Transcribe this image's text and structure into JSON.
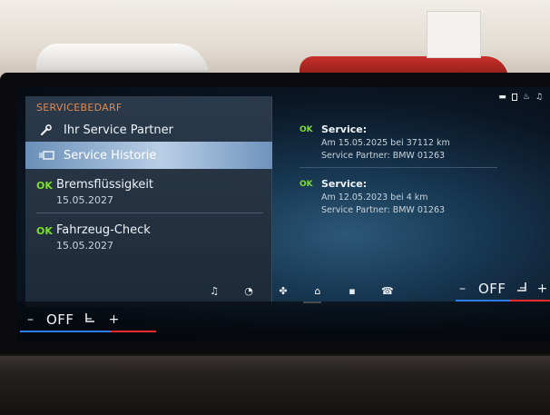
{
  "header": {
    "title": "SERVICEBEDARF"
  },
  "menu": [
    {
      "label": "Ihr Service Partner",
      "icon": "wrench-icon"
    },
    {
      "label": "Service Historie",
      "icon": "service-history-icon"
    }
  ],
  "status_items": [
    {
      "status": "OK",
      "label": "Bremsflüssigkeit",
      "date": "15.05.2027"
    },
    {
      "status": "OK",
      "label": "Fahrzeug-Check",
      "date": "15.05.2027"
    }
  ],
  "service_entries": [
    {
      "status": "OK",
      "title": "Service:",
      "line1": "Am 15.05.2025 bei 37112 km",
      "line2": "Service Partner: BMW 01263"
    },
    {
      "status": "OK",
      "title": "Service:",
      "line1": "Am 12.05.2023 bei 4 km",
      "line2": "Service Partner: BMW 01263"
    }
  ],
  "climate": {
    "left": {
      "minus": "–",
      "value": "OFF",
      "plus": "+"
    },
    "right": {
      "minus": "–",
      "value": "OFF",
      "plus": "+"
    }
  },
  "nav_bar": {
    "icons": [
      "music-icon",
      "gauge-icon",
      "fan-icon",
      "home-icon",
      "apps-icon",
      "phone-icon"
    ],
    "active": "home-icon"
  },
  "colors": {
    "accent_orange": "#e08a52",
    "ok_green": "#7dde2a",
    "highlight_blue": "#b9cfe6",
    "cold_blue": "#2f7dff",
    "warm_red": "#ff2a2a"
  }
}
